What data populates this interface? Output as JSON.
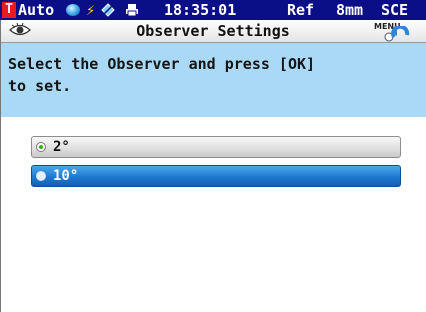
{
  "status_bar": {
    "t_icon_letter": "T",
    "mode": "Auto",
    "time": "18:35:01",
    "reference": "Ref",
    "aperture": "8mm",
    "specular": "SCE",
    "icons": [
      "target-mode-icon",
      "calibration-ball-icon",
      "flash-icon",
      "connection-icon",
      "printer-icon"
    ]
  },
  "title_bar": {
    "title": "Observer Settings",
    "menu_label": "MENU",
    "icons": [
      "observer-eye-icon",
      "menu-back-icon"
    ]
  },
  "instruction": "Select the Observer and press [OK]\nto set.",
  "options": [
    {
      "label": "2°",
      "state": "current"
    },
    {
      "label": "10°",
      "state": "highlighted"
    }
  ],
  "colors": {
    "status_bar_bg": "#0b0f87",
    "instruction_bg": "#a9d9f4",
    "highlight_blue": "#1f79cf",
    "current_dot": "#38b000"
  }
}
